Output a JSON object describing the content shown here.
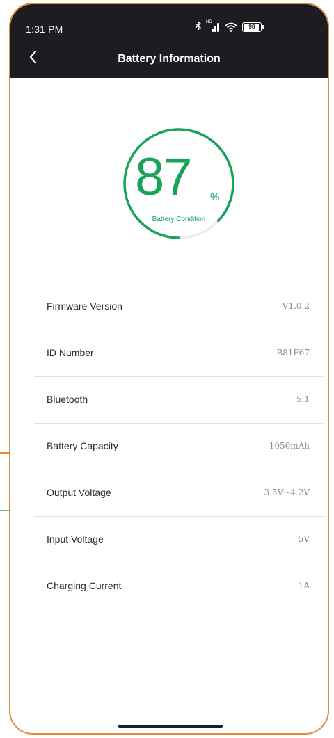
{
  "status_bar": {
    "time": "1:31 PM",
    "network_label": "HD",
    "battery_percent": 98,
    "battery_text": "98"
  },
  "header": {
    "title": "Battery Information",
    "back_icon": "chevron-left-icon"
  },
  "gauge": {
    "value": "87",
    "unit": "%",
    "fill_percent": 87,
    "label": "Battery Condition",
    "color": "#19a25a"
  },
  "info": [
    {
      "label": "Firmware Version",
      "value": "V1.0.2"
    },
    {
      "label": "ID Number",
      "value": "B81F67"
    },
    {
      "label": "Bluetooth",
      "value": "5.1"
    },
    {
      "label": "Battery Capacity",
      "value": "1050mAh"
    },
    {
      "label": "Output Voltage",
      "value": "3.5V~4.2V"
    },
    {
      "label": "Input Voltage",
      "value": "5V"
    },
    {
      "label": "Charging Current",
      "value": "1A"
    }
  ],
  "colors": {
    "frame": "#e08a3c",
    "header_bg": "#1c1c21",
    "accent": "#19a25a"
  }
}
